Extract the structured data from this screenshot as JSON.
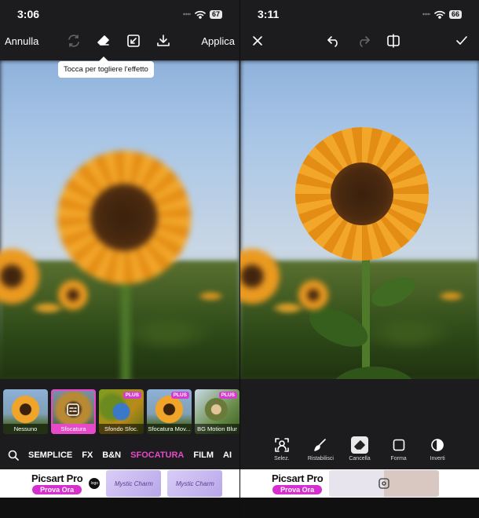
{
  "left": {
    "status": {
      "time": "3:06",
      "battery": "67"
    },
    "toolbar": {
      "cancel_label": "Annulla",
      "apply_label": "Applica",
      "icons": [
        "refresh-icon",
        "eraser-icon",
        "compare-icon",
        "download-icon"
      ]
    },
    "tooltip": "Tocca per togliere l'effetto",
    "effects": [
      {
        "label": "Nessuno",
        "plus": ""
      },
      {
        "label": "Sfocatura",
        "plus": ""
      },
      {
        "label": "Sfondo Sfoc.",
        "plus": "PLUS"
      },
      {
        "label": "Sfocatura Mov...",
        "plus": "PLUS"
      },
      {
        "label": "BG Motion Blur",
        "plus": "PLUS"
      }
    ],
    "categories": [
      "SEMPLICE",
      "FX",
      "B&N",
      "SFOCATURA",
      "FILM",
      "AI"
    ],
    "active_category": "SFOCATURA",
    "ad": {
      "brand": "Picsart Pro",
      "cta": "Prova Ora",
      "badge": "logo",
      "tile1": "Mystic Charm",
      "tile2": "Mystic Charm"
    }
  },
  "right": {
    "status": {
      "time": "3:11",
      "battery": "66"
    },
    "toolbar": {
      "icons": [
        "close-icon",
        "undo-icon",
        "redo-icon",
        "compare-icon",
        "check-icon"
      ]
    },
    "tools": [
      {
        "label": "Selez.",
        "icon": "select-person-icon"
      },
      {
        "label": "Ristabilisci",
        "icon": "brush-icon"
      },
      {
        "label": "Cancella",
        "icon": "eraser-icon"
      },
      {
        "label": "Forma",
        "icon": "shape-icon"
      },
      {
        "label": "Inverti",
        "icon": "invert-icon"
      }
    ],
    "active_tool": "Cancella",
    "ad": {
      "brand": "Picsart Pro",
      "cta": "Prova Ora"
    }
  },
  "colors": {
    "accent": "#e64ac8",
    "background": "#1c1c1e",
    "ad_cta": "#d62fd0"
  }
}
